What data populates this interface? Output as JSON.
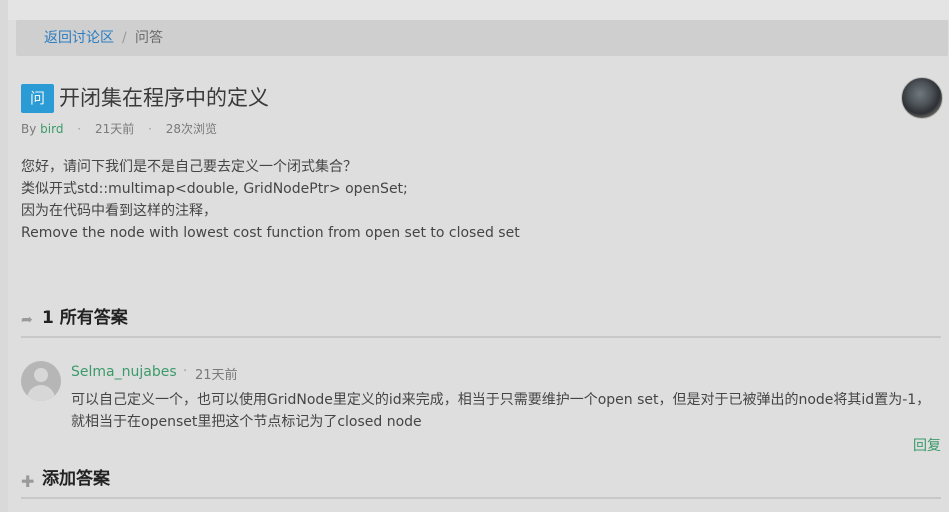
{
  "breadcrumb": {
    "back_label": "返回讨论区",
    "separator": "/",
    "current": "问答"
  },
  "question": {
    "badge": "问",
    "title": "开闭集在程序中的定义",
    "by_label": "By",
    "author": "bird",
    "time": "21天前",
    "views": "28次浏览",
    "body_lines": [
      "您好，请问下我们是不是自己要去定义一个闭式集合？",
      "类似开式std::multimap<double, GridNodePtr> openSet;",
      "因为在代码中看到这样的注释，",
      "Remove the node with lowest cost function from open set to closed set"
    ]
  },
  "answers_section": {
    "title": "1 所有答案"
  },
  "answer": {
    "author": "Selma_nujabes",
    "dot": "·",
    "time": "21天前",
    "body": "可以自己定义一个，也可以使用GridNode里定义的id来完成，相当于只需要维护一个open set，但是对于已被弹出的node将其id置为-1，就相当于在openset里把这个节点标记为了closed node",
    "reply_label": "回复"
  },
  "add_section": {
    "title": "添加答案"
  }
}
